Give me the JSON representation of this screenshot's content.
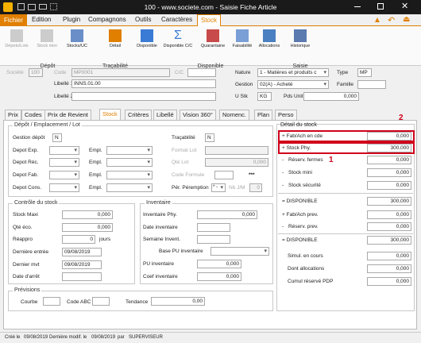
{
  "window": {
    "title": "100 - www.societe.com - Saisie Fiche Article"
  },
  "menu": {
    "file": "Fichier",
    "items": [
      "Edition",
      "Plugin",
      "Compagnons",
      "Outils",
      "Caractères",
      "Stock"
    ]
  },
  "ribbon": {
    "depot": {
      "buttons": [
        "Dépots/Lots",
        "Stock mini",
        "Stocks/UC"
      ],
      "group": "Dépôt"
    },
    "tracabilite": {
      "buttons": [
        "Détail"
      ],
      "group": "Traçabilité"
    },
    "disponible": {
      "buttons": [
        "Disponible",
        "Disponible C/C",
        "Quarantaine",
        "Faisabilité",
        "Allocations"
      ],
      "group": "Disponible"
    },
    "saisie": {
      "buttons": [
        "Historique"
      ],
      "group": "Saisie"
    }
  },
  "header": {
    "societe_label": "Société",
    "societe_value": "100",
    "code_label": "Code",
    "code_value": "MP0001",
    "cc_label": "C/C",
    "libelle1_label": "Libellé 1",
    "libelle1_value": "INNS.01.00",
    "libelle2_label": "Libellé 2",
    "nature_label": "Nature",
    "nature_value": "1 - Matières et produits c",
    "type_label": "Type",
    "type_value": "MP",
    "gestion_label": "Gestion",
    "gestion_value": "02(A) - Acheté",
    "famille_label": "Famille",
    "ustk_label": "U Stk",
    "ustk_value": "KG",
    "pdsunit_label": "Pds Unit",
    "pdsunit_value": "0,000"
  },
  "tabs": [
    "Prix",
    "Codes",
    "Prix de Revient",
    "Stock",
    "Critères",
    "Libellé",
    "Vision 360°",
    "Nomenc.",
    "Plan",
    "Perso"
  ],
  "depot": {
    "title": "Dépôt / Emplacement / Lot",
    "gestion_label": "Gestion dépôt",
    "gestion_value": "N",
    "tracabilite_label": "Traçabilité",
    "tracabilite_value": "N",
    "rows": [
      "Depot Exp.",
      "Depot Réc.",
      "Depot Fab.",
      "Depot Cons."
    ],
    "empl_label": "Empl.",
    "format_lot": "Format Lot",
    "qte_lot": "Qté Lot",
    "qte_lot_value": "0,000",
    "code_formule": "Code Formule",
    "stars": "***",
    "per_label": "Pér. Péremption",
    "per_value": "* -",
    "nb_label": "Nb J/M",
    "nb_value": "0"
  },
  "controle": {
    "title": "Contrôle du stock",
    "rows": [
      {
        "label": "Stock Maxi",
        "value": "0,000"
      },
      {
        "label": "Qté éco.",
        "value": "0,000"
      },
      {
        "label": "Réappro",
        "value": "0",
        "unit": "jours"
      },
      {
        "label": "Dernière entrée",
        "value": "09/08/2019"
      },
      {
        "label": "Dernier mvt",
        "value": "09/08/2019"
      },
      {
        "label": "Date d'arrêt",
        "value": ""
      }
    ]
  },
  "inventaire": {
    "title": "Inventaire",
    "phy_label": "Inventaire Phy.",
    "phy_value": "0,000",
    "date_label": "Date inventaire",
    "semaine_label": "Semaine Invent.",
    "base_label": "Base PU inventaire",
    "pu_label": "PU inventaire",
    "pu_value": "0,000",
    "coef_label": "Coef inventaire",
    "coef_value": "0,000"
  },
  "previsions": {
    "title": "Prévisions",
    "courbe": "Courbe",
    "abc": "Code ABC",
    "tendance": "Tendance",
    "tendance_value": "0,00"
  },
  "detail": {
    "title": "Détail du stock",
    "rows": [
      {
        "sign": "+",
        "label": "Fab/Ach en cde",
        "value": "0,000"
      },
      {
        "sign": "+",
        "label": "Stock Phy.",
        "value": "300,000"
      },
      {
        "sign": "-",
        "label": "Réserv. fermes",
        "value": "0,000"
      },
      {
        "sign": "-",
        "label": "Stock mini",
        "value": "0,000"
      },
      {
        "sign": "-",
        "label": "Stock sécurité",
        "value": "0,000"
      },
      {
        "sign": "=",
        "label": "DISPONIBLE",
        "value": "300,000"
      },
      {
        "sign": "+",
        "label": "Fab/Ach prev.",
        "value": "0,000"
      },
      {
        "sign": "-",
        "label": "Réserv. prev.",
        "value": "0,000"
      },
      {
        "sign": "=",
        "label": "DISPONIBLE",
        "value": "300,000"
      },
      {
        "sign": "",
        "label": "Simul. en cours",
        "value": "0,000"
      },
      {
        "sign": "",
        "label": "Dont allocations",
        "value": "0,000"
      },
      {
        "sign": "",
        "label": "Cumul réservé PDP",
        "value": "0,000"
      }
    ],
    "annotation1": "1",
    "annotation2": "2"
  },
  "status": {
    "cree_label": "Créé le",
    "cree_value": "09/08/2019",
    "modif_label": "Dernière modif. le",
    "modif_value": "09/08/2019",
    "par_label": "par",
    "par_value": "SUPERVISEUR"
  },
  "colors": {
    "accent": "#e07f00",
    "title_bar": "#1a1a1a",
    "highlight": "#d0021b"
  },
  "icons": [
    "app-icon",
    "save-icon",
    "print-icon",
    "mail-icon",
    "grid-icon",
    "minimize-icon",
    "maximize-icon",
    "close-icon",
    "warning-icon",
    "undo-icon",
    "exit-icon"
  ]
}
